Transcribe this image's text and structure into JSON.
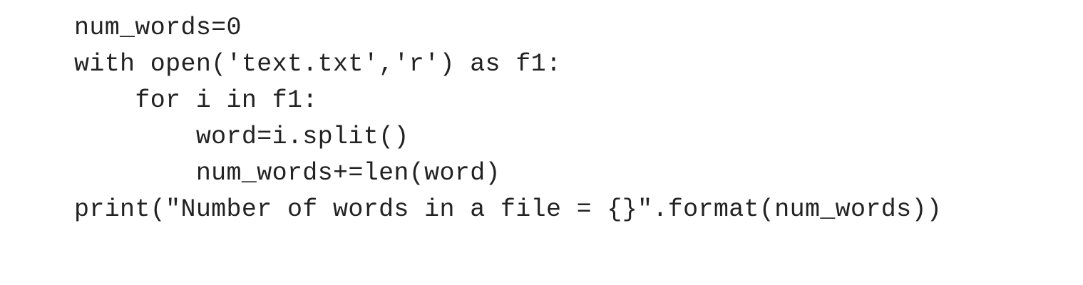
{
  "code": {
    "lines": [
      "num_words=0",
      "with open('text.txt','r') as f1:",
      "    for i in f1:",
      "        word=i.split()",
      "        num_words+=len(word)",
      "print(\"Number of words in a file = {}\".format(num_words))"
    ]
  }
}
